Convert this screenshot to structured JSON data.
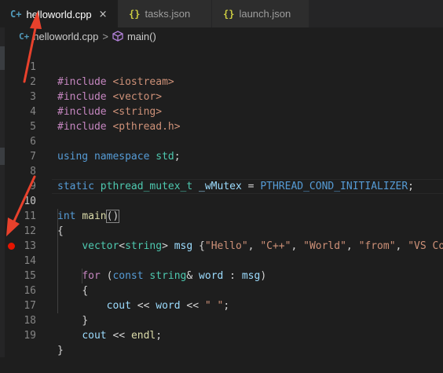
{
  "tabs": [
    {
      "icon": "C+",
      "label": "helloworld.cpp",
      "close": "×",
      "active": true
    },
    {
      "icon": "{}",
      "label": "tasks.json",
      "active": false
    },
    {
      "icon": "{}",
      "label": "launch.json",
      "active": false
    }
  ],
  "breadcrumb": {
    "file": "helloworld.cpp",
    "separator": ">",
    "symbol": "main()"
  },
  "editor": {
    "line_numbers": [
      "1",
      "2",
      "3",
      "4",
      "5",
      "6",
      "7",
      "8",
      "9",
      "10",
      "11",
      "12",
      "13",
      "14",
      "15",
      "16",
      "17",
      "18",
      "19"
    ],
    "code": {
      "l1": [
        "#include",
        "<iostream>"
      ],
      "l2": [
        "#include",
        "<vector>"
      ],
      "l3": [
        "#include",
        "<string>"
      ],
      "l4": [
        "#include",
        "<pthread.h>"
      ],
      "l6": [
        "using",
        "namespace",
        "std",
        ";"
      ],
      "l8": [
        "static",
        "pthread_mutex_t",
        "_wMutex",
        " = ",
        "PTHREAD_COND_INITIALIZER",
        ";"
      ],
      "l10": [
        "int",
        "main",
        "()"
      ],
      "l11": [
        "{"
      ],
      "l12": [
        "vector",
        "<",
        "string",
        "> ",
        "msg",
        " {",
        "\"Hello\"",
        ", ",
        "\"C++\"",
        ", ",
        "\"World\"",
        ", ",
        "\"from\"",
        ", ",
        "\"VS Cod"
      ],
      "l14": [
        "for",
        " (",
        "const",
        "string",
        "& ",
        "word",
        " : ",
        "msg",
        ")"
      ],
      "l15": [
        "{"
      ],
      "l16": [
        "cout",
        " << ",
        "word",
        " << ",
        "\" \"",
        ";"
      ],
      "l17": [
        "}"
      ],
      "l18": [
        "cout",
        " << ",
        "endl",
        ";"
      ],
      "l19": [
        "}"
      ]
    },
    "breakpoint_line": "14",
    "current_line": "10"
  },
  "colors": {
    "background": "#1e1e1e",
    "keyword": "#569cd6",
    "preprocessor": "#c586c0",
    "string": "#ce9178",
    "type": "#4ec9b0",
    "variable": "#9cdcfe",
    "function": "#dcdcaa",
    "breakpoint": "#e51400",
    "annotation_arrow": "#e8412c"
  }
}
